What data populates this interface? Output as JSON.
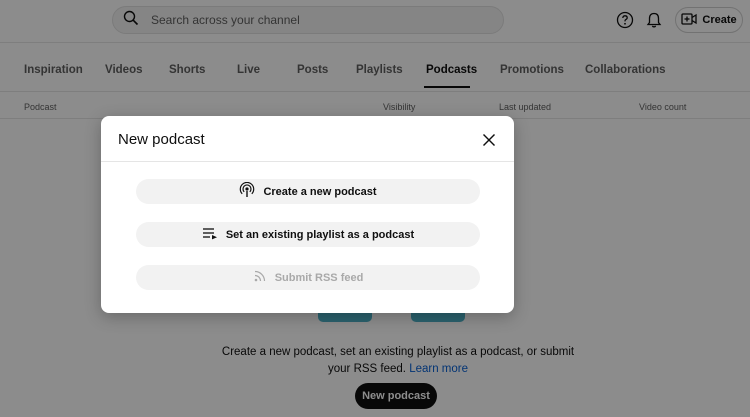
{
  "header": {
    "search_placeholder": "Search across your channel",
    "create_label": "Create"
  },
  "tabs": [
    {
      "label": "Inspiration"
    },
    {
      "label": "Videos"
    },
    {
      "label": "Shorts"
    },
    {
      "label": "Live"
    },
    {
      "label": "Posts"
    },
    {
      "label": "Playlists"
    },
    {
      "label": "Podcasts",
      "active": true
    },
    {
      "label": "Promotions"
    },
    {
      "label": "Collaborations"
    }
  ],
  "columns": [
    "Podcast",
    "Visibility",
    "Last updated",
    "Video count"
  ],
  "empty_state": {
    "message": "Create a new podcast, set an existing playlist as a podcast, or submit your RSS feed.",
    "learn_more": "Learn more",
    "button_label": "New podcast"
  },
  "modal": {
    "title": "New podcast",
    "options": [
      {
        "label": "Create a new podcast",
        "icon": "podcast-icon",
        "enabled": true
      },
      {
        "label": "Set an existing playlist as a podcast",
        "icon": "playlist-add-icon",
        "enabled": true
      },
      {
        "label": "Submit RSS feed",
        "icon": "rss-feed-icon",
        "enabled": false
      }
    ]
  },
  "colors": {
    "text_primary": "#0f0f0f",
    "text_secondary": "#606060",
    "link": "#065fd4",
    "chip_bg": "#f2f2f2",
    "disabled_text": "#a9a9a9"
  }
}
